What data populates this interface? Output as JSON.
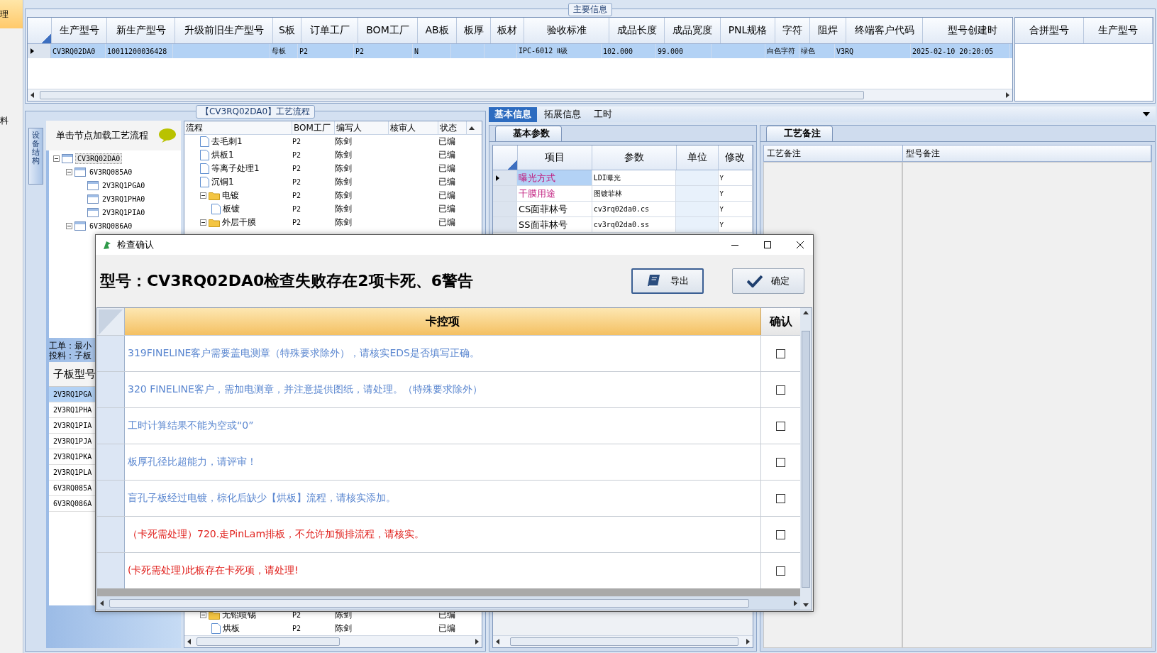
{
  "side_strip": {
    "items": [
      {
        "label": "理",
        "selected": true
      },
      {
        "label": "料",
        "selected": false
      }
    ]
  },
  "main_info": {
    "title": "主要信息",
    "columns": [
      "生产型号",
      "新生产型号",
      "升级前旧生产型号",
      "S板",
      "订单工厂",
      "BOM工厂",
      "AB板",
      "板厚",
      "板材",
      "验收标准",
      "成品长度",
      "成品宽度",
      "PNL规格",
      "字符",
      "阻焊",
      "终端客户代码",
      "型号创建时"
    ],
    "rows": [
      {
        "selected": true,
        "cells": [
          "CV3RQ02DA0",
          "10011200036428",
          null,
          "母板",
          "P2",
          "P2",
          "N",
          null,
          null,
          "IPC-6012 Ⅱ级",
          "102.000",
          "99.000",
          null,
          "白色字符",
          "绿色",
          "V3RQ",
          "2025-02-10 20:20:05"
        ]
      }
    ],
    "merge_columns": [
      "合拼型号",
      "生产型号"
    ]
  },
  "flow_panel": {
    "title": "【CV3RQ02DA0】工艺流程",
    "side_tab": "设备结构",
    "hint": "单击节点加载工艺流程",
    "tree": [
      {
        "label": "CV3RQ02DA0",
        "expanded": true,
        "selected": true,
        "children": [
          {
            "label": "6V3RQ085A0",
            "expanded": true,
            "selected": false,
            "children": [
              {
                "label": "2V3RQ1PGA0",
                "selected": false
              },
              {
                "label": "2V3RQ1PHA0",
                "selected": false
              },
              {
                "label": "2V3RQ1PIA0",
                "selected": false
              }
            ]
          },
          {
            "label": "6V3RQ086A0",
            "expanded": true,
            "selected": false
          }
        ]
      }
    ],
    "notes": [
      "工单：最小",
      "投料：子板"
    ],
    "sub_table": {
      "column": "子板型号",
      "rows": [
        {
          "label": "2V3RQ1PGA",
          "selected": true
        },
        {
          "label": "2V3RQ1PHA",
          "selected": false
        },
        {
          "label": "2V3RQ1PIA",
          "selected": false
        },
        {
          "label": "2V3RQ1PJA",
          "selected": false
        },
        {
          "label": "2V3RQ1PKA",
          "selected": false
        },
        {
          "label": "2V3RQ1PLA",
          "selected": false
        },
        {
          "label": "6V3RQ085A",
          "selected": false
        },
        {
          "label": "6V3RQ086A",
          "selected": false
        }
      ]
    },
    "flow_columns": [
      "流程",
      "BOM工厂",
      "编写人",
      "核审人",
      "状态"
    ],
    "flow_rows_top": [
      {
        "kind": "step",
        "name": "去毛刺1",
        "factory": "P2",
        "writer": "陈剑",
        "status": "已编"
      },
      {
        "kind": "step",
        "name": "烘板1",
        "factory": "P2",
        "writer": "陈剑",
        "status": "已编"
      },
      {
        "kind": "step",
        "name": "等离子处理1",
        "factory": "P2",
        "writer": "陈剑",
        "status": "已编"
      },
      {
        "kind": "step",
        "name": "沉铜1",
        "factory": "P2",
        "writer": "陈剑",
        "status": "已编"
      },
      {
        "kind": "folder",
        "name": "电镀",
        "factory": "P2",
        "writer": "陈剑",
        "status": "已编",
        "expanded": true,
        "children": [
          {
            "kind": "step",
            "name": "板镀",
            "factory": "P2",
            "writer": "陈剑",
            "status": "已编"
          }
        ]
      },
      {
        "kind": "folder",
        "name": "外层干膜",
        "factory": "P2",
        "writer": "陈剑",
        "status": "已编",
        "expanded": true
      }
    ],
    "flow_rows_bottom": [
      {
        "kind": "folder",
        "name": "无铅喷锡",
        "factory": "P2",
        "writer": "陈剑",
        "status": "已编",
        "expanded": true,
        "children": [
          {
            "kind": "step",
            "name": "烘板",
            "factory": "P2",
            "writer": "陈剑",
            "status": "已编"
          }
        ]
      }
    ]
  },
  "detail": {
    "tabs": [
      {
        "label": "基本信息",
        "selected": true
      },
      {
        "label": "拓展信息",
        "selected": false
      },
      {
        "label": "工时",
        "selected": false
      }
    ],
    "params_tab": "基本参数",
    "param_columns": [
      "项目",
      "参数",
      "单位",
      "修改"
    ],
    "params": [
      {
        "item": "曝光方式",
        "value": "LDI曝光",
        "modify": "Y",
        "selected": true,
        "color": "#c0187c"
      },
      {
        "item": "干膜用途",
        "value": "图镀菲林",
        "modify": "Y",
        "selected": false,
        "color": "#c0187c"
      },
      {
        "item": "CS面菲林号",
        "value": "cv3rq02da0.cs",
        "modify": "Y",
        "selected": false,
        "color": "#000000"
      },
      {
        "item": "SS面菲林号",
        "value": "cv3rq02da0.ss",
        "modify": "Y",
        "selected": false,
        "color": "#000000"
      }
    ],
    "notes_tab": "工艺备注",
    "note_columns": [
      "工艺备注",
      "型号备注"
    ]
  },
  "dialog": {
    "title": "检查确认",
    "heading": "型号：CV3RQ02DA0检查失败存在2项卡死、6警告",
    "buttons": [
      {
        "label": "导出",
        "kind": "export"
      },
      {
        "label": "确定",
        "kind": "confirm"
      }
    ],
    "columns": [
      "卡控项",
      "确认"
    ],
    "rows": [
      {
        "kind": "warning",
        "text": "319FINELINE客户需要盖电测章（特殊要求除外），请核实EDS是否填写正确。",
        "checked": false
      },
      {
        "kind": "warning",
        "text": "320 FINELINE客户，需加电测章，并注意提供图纸，请处理。（特殊要求除外）",
        "checked": false
      },
      {
        "kind": "warning",
        "text": "工时计算结果不能为空或“0”",
        "checked": false
      },
      {
        "kind": "warning",
        "text": "板厚孔径比超能力，请评审！",
        "checked": false
      },
      {
        "kind": "warning",
        "text": "盲孔子板经过电镀，棕化后缺少【烘板】流程，请核实添加。",
        "checked": false
      },
      {
        "kind": "blocking",
        "text": "（卡死需处理）720.走PinLam排板，不允许加预排流程，请核实。",
        "checked": false
      },
      {
        "kind": "blocking",
        "text": "(卡死需处理)此板存在卡死项，请处理!",
        "checked": false
      }
    ]
  }
}
